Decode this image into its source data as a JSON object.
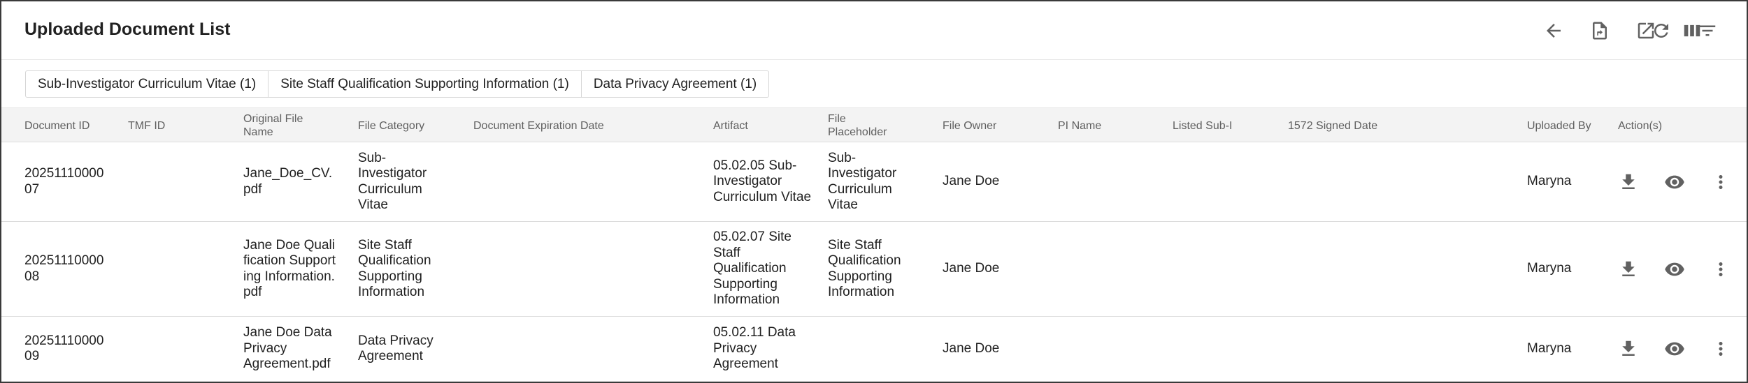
{
  "header": {
    "title": "Uploaded Document List",
    "tools": [
      "arrow-left-icon",
      "document-export-icon",
      "open-external-icon",
      "columns-icon",
      "refresh-icon",
      "filter-icon"
    ]
  },
  "chips": [
    "Sub-Investigator Curriculum Vitae (1)",
    "Site Staff Qualification Supporting Information (1)",
    "Data Privacy Agreement (1)"
  ],
  "table": {
    "columns": {
      "doc_id": "Document ID",
      "tmf_id": "TMF ID",
      "orig_name": "Original File Name",
      "category": "File Category",
      "expiration": "Document Expiration Date",
      "artifact": "Artifact",
      "placeholder": "File Placeholder",
      "owner": "File Owner",
      "pi_name": "PI Name",
      "listed_sub": "Listed Sub-I",
      "signed_1572": "1572 Signed Date",
      "uploaded_by": "Uploaded By",
      "actions": "Action(s)"
    },
    "rows": [
      {
        "doc_id": "2025111000007",
        "tmf_id": "",
        "orig_name": "Jane_Doe_CV.pdf",
        "category": "Sub-Investigator Curriculum Vitae",
        "expiration": "",
        "artifact": "05.02.05 Sub-Investigator Curriculum Vitae",
        "placeholder": "Sub-Investigator Curriculum Vitae",
        "owner": "Jane Doe",
        "pi_name": "",
        "listed_sub": "",
        "signed_1572": "",
        "uploaded_by": "Maryna"
      },
      {
        "doc_id": "2025111000008",
        "tmf_id": "",
        "orig_name": "Jane Doe Qualification Supporting Information.pdf",
        "category": "Site Staff Qualification Supporting Information",
        "expiration": "",
        "artifact": "05.02.07 Site Staff Qualification Supporting Information",
        "placeholder": "Site Staff Qualification Supporting Information",
        "owner": "Jane Doe",
        "pi_name": "",
        "listed_sub": "",
        "signed_1572": "",
        "uploaded_by": "Maryna"
      },
      {
        "doc_id": "2025111000009",
        "tmf_id": "",
        "orig_name": "Jane Doe Data Privacy Agreement.pdf",
        "category": "Data Privacy Agreement",
        "expiration": "",
        "artifact": "05.02.11 Data Privacy Agreement",
        "placeholder": "",
        "owner": "Jane Doe",
        "pi_name": "",
        "listed_sub": "",
        "signed_1572": "",
        "uploaded_by": "Maryna"
      }
    ],
    "row_actions": [
      "download-icon",
      "view-icon",
      "more-vert-icon"
    ]
  },
  "colors": {
    "icon": "#616161",
    "header_bg": "#f3f3f3",
    "border": "#dcdcdc"
  }
}
